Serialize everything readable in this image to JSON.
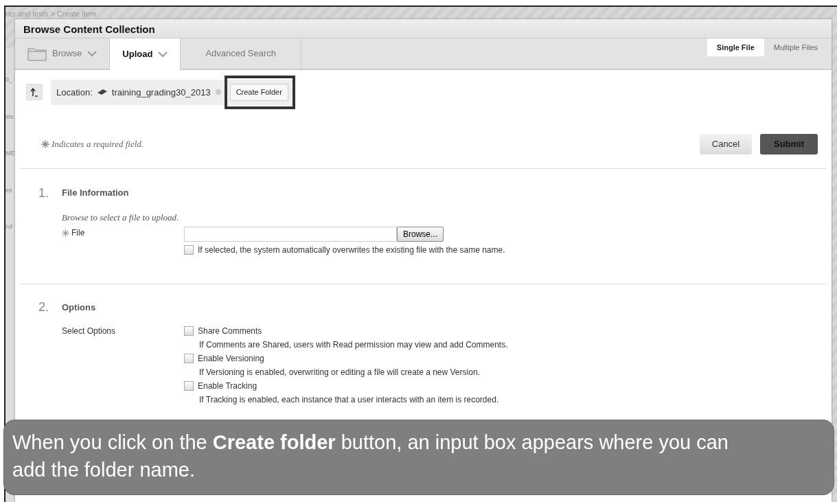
{
  "background": {
    "breadcrumb": "nts and tests > Create Item",
    "fragments": [
      "0_",
      "sts",
      "ME",
      "es",
      "rol"
    ]
  },
  "dialog": {
    "title": "Browse Content Collection",
    "tabs": [
      {
        "label": "Browse",
        "kind": "folder",
        "selected": false
      },
      {
        "label": "Upload",
        "kind": "menu",
        "selected": true
      },
      {
        "label": "Advanced Search",
        "kind": "plain",
        "selected": false
      }
    ],
    "mode_tabs": [
      {
        "label": "Single File",
        "selected": true
      },
      {
        "label": "Multiple Files",
        "selected": false
      }
    ],
    "location": {
      "label": "Location:",
      "path": "training_grading30_2013",
      "button": "Create Folder",
      "highlighted": true
    },
    "required_note": "Indicates a required field.",
    "buttons": [
      {
        "label": "Cancel",
        "kind": "secondary"
      },
      {
        "label": "Submit",
        "kind": "primary"
      }
    ],
    "sections": [
      {
        "number": "1.",
        "title": "File Information",
        "hint": "Browse to select a file to upload.",
        "file_label": "File",
        "browse_button": "Browse...",
        "options": [
          {
            "label": "If selected, the system automatically overwrites the existing file with the same name.",
            "checked": false
          }
        ]
      },
      {
        "number": "2.",
        "title": "Options",
        "group_label": "Select Options",
        "options": [
          {
            "label": "Share Comments",
            "description": "If Comments are Shared, users with Read permission may view and add Comments.",
            "checked": false
          },
          {
            "label": "Enable Versioning",
            "description": "If Versioning is enabled, overwriting or editing a file will create a new Version.",
            "checked": false
          },
          {
            "label": "Enable Tracking",
            "description": "If Tracking is enabled, each instance that a user interacts with an item is recorded.",
            "checked": false
          }
        ]
      }
    ]
  },
  "caption": "When you click on the **Create folder** button, an input box appears where you can add the folder name."
}
